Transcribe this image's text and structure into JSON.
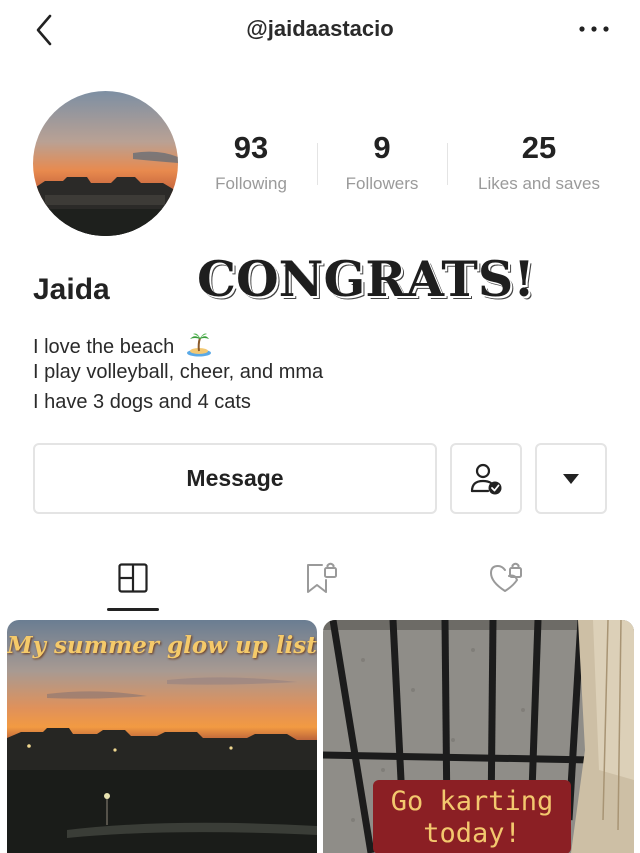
{
  "header": {
    "handle": "@jaidaastacio",
    "back_icon": "chevron-left-icon",
    "more_icon": "more-horizontal-icon"
  },
  "profile": {
    "name": "Jaida",
    "overlay_text": "CONGRATS!",
    "bio": [
      "I love the beach",
      "I play volleyball, cheer, and mma",
      "I have 3 dogs and 4 cats"
    ],
    "bio_emoji": "desert-island-icon"
  },
  "stats": {
    "following": {
      "value": "93",
      "label": "Following"
    },
    "followers": {
      "value": "9",
      "label": "Followers"
    },
    "likes": {
      "value": "25",
      "label": "Likes and saves"
    }
  },
  "actions": {
    "message_label": "Message",
    "follow_icon": "user-check-icon",
    "dropdown_icon": "caret-down-icon"
  },
  "tabs": [
    {
      "icon": "grid-icon",
      "active": true
    },
    {
      "icon": "bookmark-lock-icon",
      "active": false
    },
    {
      "icon": "heart-lock-icon",
      "active": false
    }
  ],
  "posts": [
    {
      "caption": "My summer glow up list"
    },
    {
      "caption_line1": "Go karting",
      "caption_line2": "today!"
    }
  ],
  "colors": {
    "text": "#222222",
    "muted": "#9a9a9a",
    "border": "#e4e4e4",
    "caption_gold": "#f5ca6a",
    "caption_bg": "#8b1f24"
  }
}
